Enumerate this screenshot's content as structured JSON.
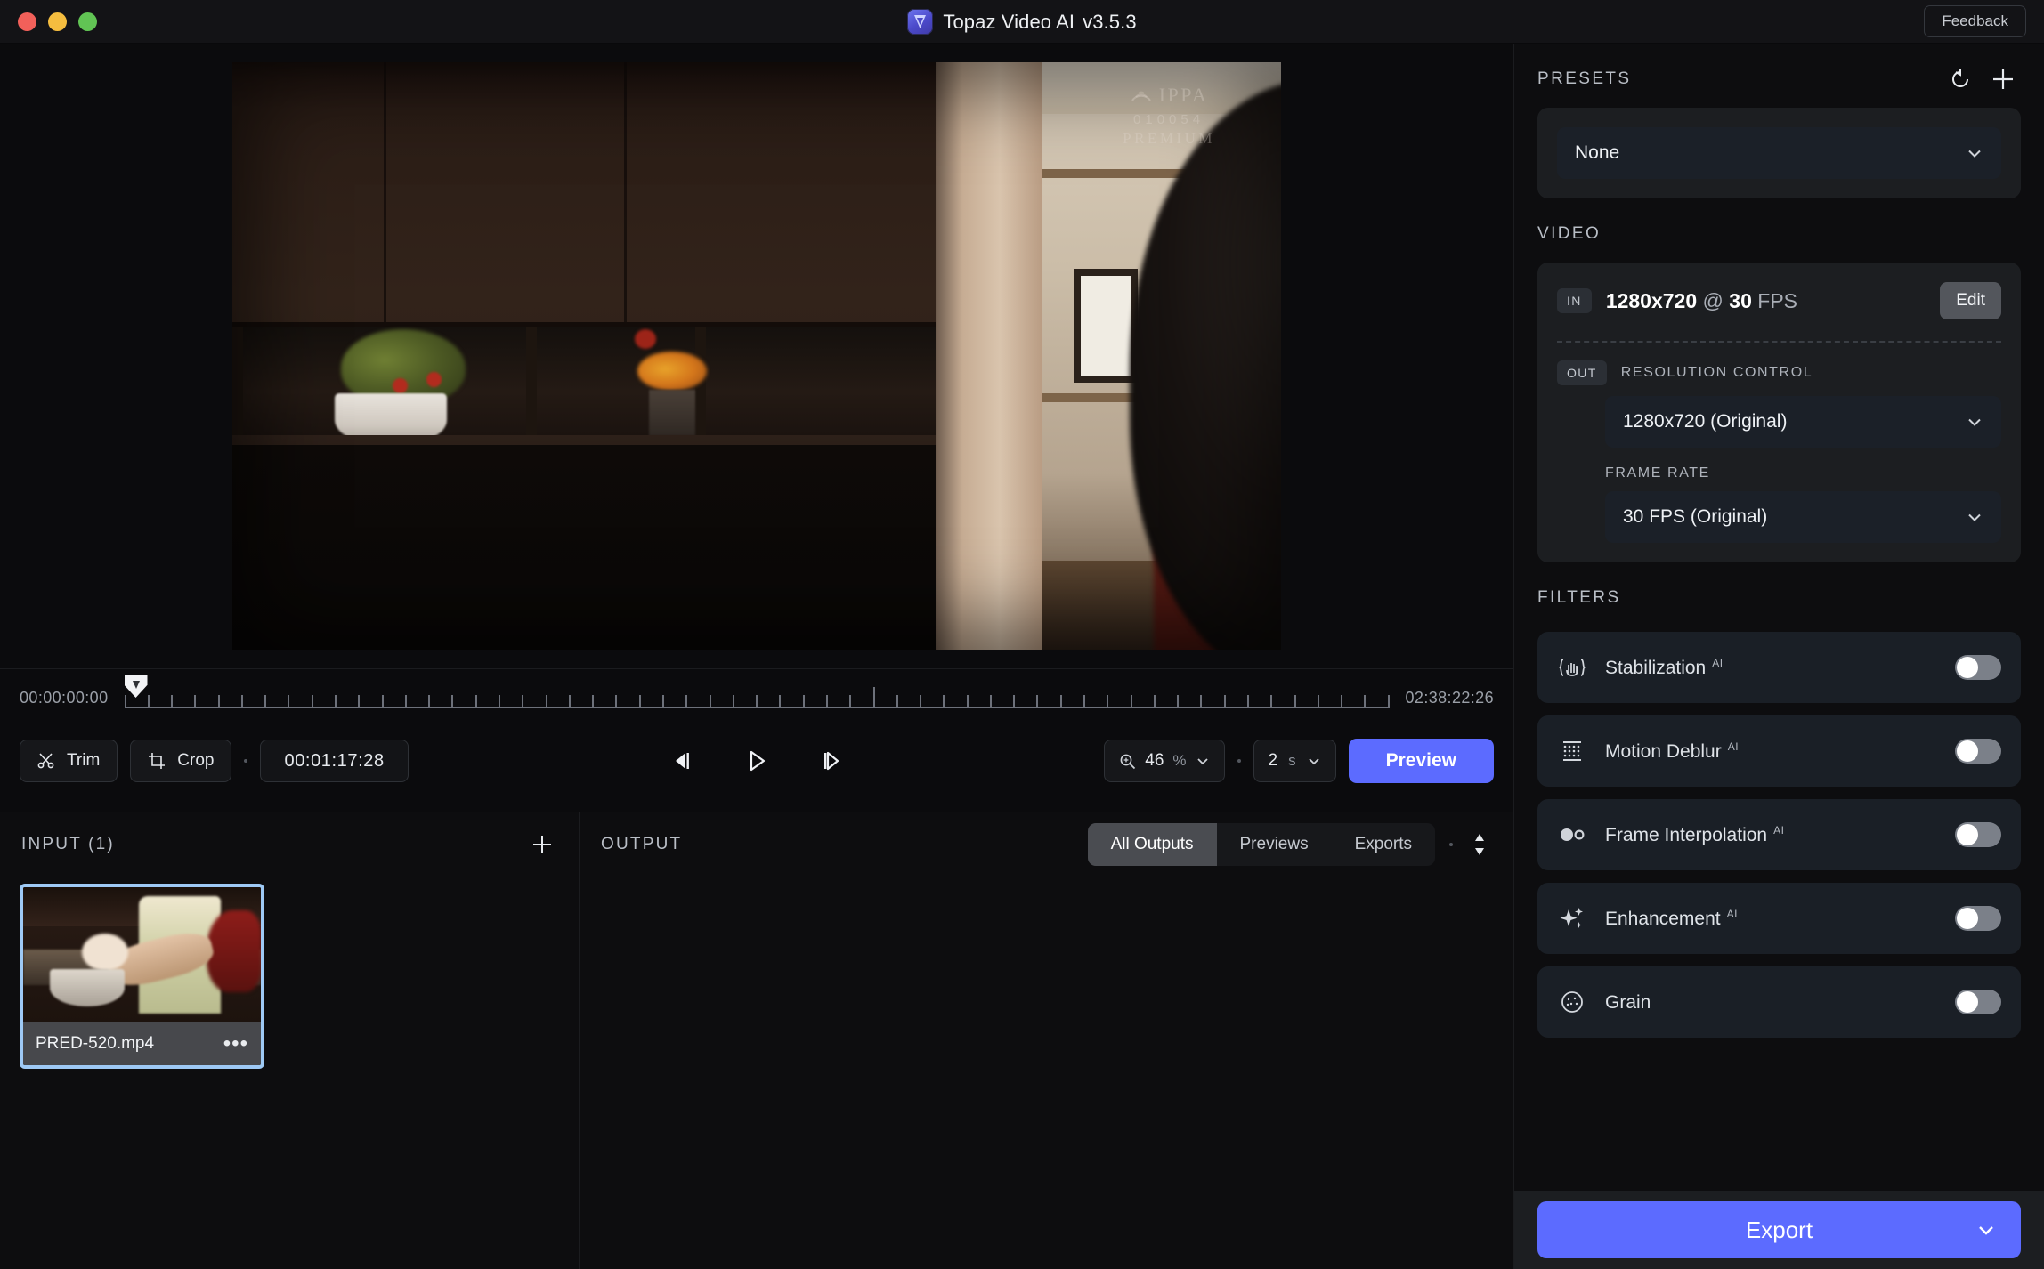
{
  "window": {
    "title": "Topaz Video AI",
    "version": "v3.5.3",
    "feedback_label": "Feedback"
  },
  "preview": {
    "watermark_name": "IPPA",
    "watermark_number": "010054",
    "watermark_tier": "PREMIUM"
  },
  "timeline": {
    "start_timecode": "00:00:00:00",
    "end_timecode": "02:38:22:26",
    "trim_label": "Trim",
    "crop_label": "Crop",
    "duration_value": "00:01:17:28",
    "zoom_value": "46",
    "zoom_unit": "%",
    "interval_value": "2",
    "interval_unit": "s",
    "preview_label": "Preview"
  },
  "input": {
    "title": "INPUT (1)",
    "files": [
      {
        "name": "PRED-520.mp4"
      }
    ]
  },
  "output": {
    "title": "OUTPUT",
    "tabs": [
      {
        "label": "All Outputs",
        "active": true
      },
      {
        "label": "Previews",
        "active": false
      },
      {
        "label": "Exports",
        "active": false
      }
    ]
  },
  "presets": {
    "title": "PRESETS",
    "selected": "None"
  },
  "video": {
    "title": "VIDEO",
    "in_badge": "IN",
    "in_resolution": "1280x720",
    "in_at": "@",
    "in_fps": "30",
    "in_fps_unit": "FPS",
    "edit_label": "Edit",
    "out_badge": "OUT",
    "resolution_control_label": "RESOLUTION CONTROL",
    "resolution_value": "1280x720 (Original)",
    "frame_rate_label": "FRAME RATE",
    "frame_rate_value": "30 FPS (Original)"
  },
  "filters": {
    "title": "FILTERS",
    "items": [
      {
        "label": "Stabilization",
        "ai": "AI",
        "enabled": false,
        "icon": "hand-stabilize-icon"
      },
      {
        "label": "Motion Deblur",
        "ai": "AI",
        "enabled": false,
        "icon": "grid-dots-icon"
      },
      {
        "label": "Frame Interpolation",
        "ai": "AI",
        "enabled": false,
        "icon": "two-circles-icon"
      },
      {
        "label": "Enhancement",
        "ai": "AI",
        "enabled": false,
        "icon": "sparkle-icon"
      },
      {
        "label": "Grain",
        "ai": "",
        "enabled": false,
        "icon": "grain-icon"
      }
    ]
  },
  "export": {
    "label": "Export"
  },
  "colors": {
    "accent": "#5c6bff",
    "selection": "#9ec9f5",
    "panel": "#1c1e21",
    "filter_row": "#1a1f26",
    "background": "#0d0d0f"
  }
}
